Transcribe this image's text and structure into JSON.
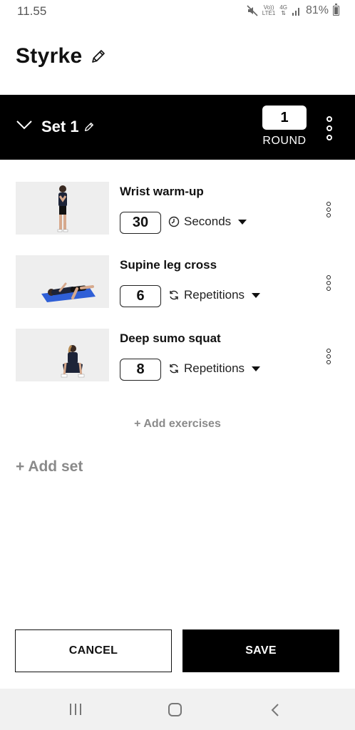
{
  "status_bar": {
    "time": "11.55",
    "network_top": "Vo))",
    "network_bottom": "LTE1",
    "gen_label": "4G",
    "battery": "81%"
  },
  "header": {
    "title": "Styrke"
  },
  "set": {
    "label": "Set 1",
    "rounds_value": "1",
    "rounds_label": "ROUND"
  },
  "exercises": [
    {
      "name": "Wrist warm-up",
      "value": "30",
      "unit": "Seconds",
      "unit_icon": "clock-icon"
    },
    {
      "name": "Supine leg cross",
      "value": "6",
      "unit": "Repetitions",
      "unit_icon": "repeat-icon"
    },
    {
      "name": "Deep sumo squat",
      "value": "8",
      "unit": "Repetitions",
      "unit_icon": "repeat-icon"
    }
  ],
  "actions": {
    "add_exercises": "+ Add exercises",
    "add_set": "+ Add set",
    "cancel": "CANCEL",
    "save": "SAVE"
  }
}
